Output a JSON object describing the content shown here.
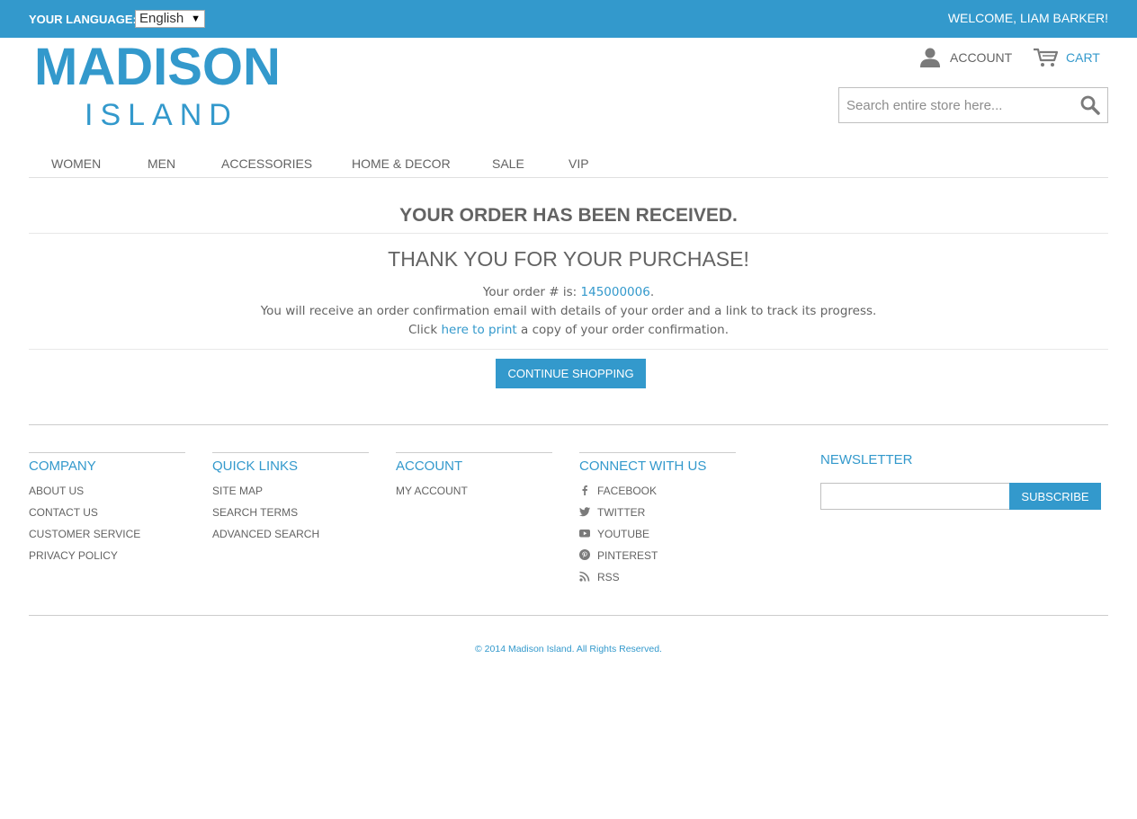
{
  "header": {
    "language_label": "YOUR LANGUAGE:",
    "language_selected": "English",
    "welcome": "WELCOME, LIAM BARKER!",
    "logo_main": "MADISON",
    "logo_sub": "ISLAND",
    "account_label": "ACCOUNT",
    "cart_label": "CART",
    "search_placeholder": "Search entire store here..."
  },
  "nav": {
    "items": [
      "WOMEN",
      "MEN",
      "ACCESSORIES",
      "HOME & DECOR",
      "SALE",
      "VIP"
    ]
  },
  "main": {
    "title": "YOUR ORDER HAS BEEN RECEIVED.",
    "subtitle": "THANK YOU FOR YOUR PURCHASE!",
    "order_prefix": "Your order # is: ",
    "order_number": "145000006",
    "order_suffix": ".",
    "email_message": "You will receive an order confirmation email with details of your order and a link to track its progress.",
    "print_prefix": "Click ",
    "print_link": "here to print",
    "print_suffix": " a copy of your order confirmation.",
    "continue_button": "CONTINUE SHOPPING"
  },
  "footer": {
    "company": {
      "title": "COMPANY",
      "items": [
        "ABOUT US",
        "CONTACT US",
        "CUSTOMER SERVICE",
        "PRIVACY POLICY"
      ]
    },
    "quick_links": {
      "title": "QUICK LINKS",
      "items": [
        "SITE MAP",
        "SEARCH TERMS",
        "ADVANCED SEARCH"
      ]
    },
    "account": {
      "title": "ACCOUNT",
      "items": [
        "MY ACCOUNT"
      ]
    },
    "connect": {
      "title": "CONNECT WITH US",
      "items": [
        {
          "label": "FACEBOOK",
          "icon": "facebook-icon"
        },
        {
          "label": "TWITTER",
          "icon": "twitter-icon"
        },
        {
          "label": "YOUTUBE",
          "icon": "youtube-icon"
        },
        {
          "label": "PINTEREST",
          "icon": "pinterest-icon"
        },
        {
          "label": "RSS",
          "icon": "rss-icon"
        }
      ]
    },
    "newsletter": {
      "title": "NEWSLETTER",
      "subscribe_button": "SUBSCRIBE"
    },
    "copyright": "© 2014 Madison Island. All Rights Reserved."
  },
  "colors": {
    "brand": "#3399cc",
    "text": "#636363"
  }
}
